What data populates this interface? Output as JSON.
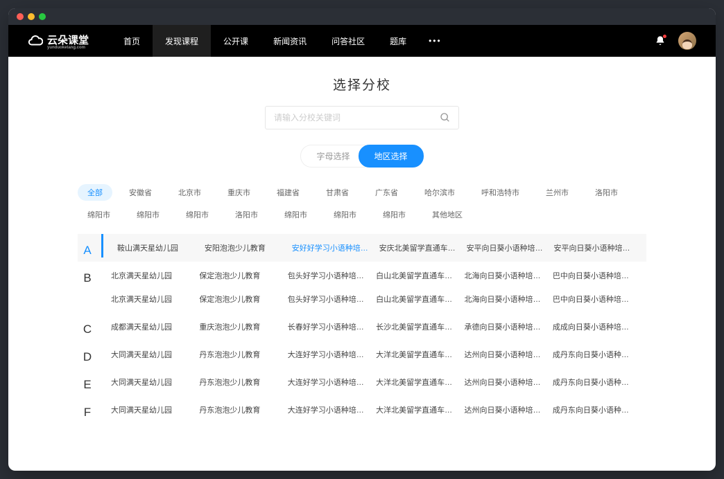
{
  "logo": {
    "text": "云朵课堂",
    "sub": "yunduoketang.com"
  },
  "nav": [
    "首页",
    "发现课程",
    "公开课",
    "新闻资讯",
    "问答社区",
    "题库"
  ],
  "nav_active": 1,
  "page_title": "选择分校",
  "search": {
    "placeholder": "请输入分校关键词"
  },
  "tabs": [
    "字母选择",
    "地区选择"
  ],
  "tab_active": 1,
  "regions": [
    "全部",
    "安徽省",
    "北京市",
    "重庆市",
    "福建省",
    "甘肃省",
    "广东省",
    "哈尔滨市",
    "呼和浩特市",
    "兰州市",
    "洛阳市",
    "绵阳市",
    "绵阳市",
    "绵阳市",
    "洛阳市",
    "绵阳市",
    "绵阳市",
    "绵阳市",
    "其他地区"
  ],
  "region_active": 0,
  "groups": [
    {
      "letter": "A",
      "highlighted": true,
      "highlight_idx": 2,
      "items": [
        "鞍山满天星幼儿园",
        "安阳泡泡少儿教育",
        "安好好学习小语种培训班",
        "安庆北美留学直通车分校",
        "安平向日葵小语种培训班",
        "安平向日葵小语种培训班"
      ]
    },
    {
      "letter": "B",
      "items": [
        "北京满天星幼儿园",
        "保定泡泡少儿教育",
        "包头好学习小语种培训班",
        "白山北美留学直通车分校",
        "北海向日葵小语种培训班",
        "巴中向日葵小语种培训班",
        "北京满天星幼儿园",
        "保定泡泡少儿教育",
        "包头好学习小语种培训班",
        "白山北美留学直通车分校",
        "北海向日葵小语种培训班",
        "巴中向日葵小语种培训班"
      ]
    },
    {
      "letter": "C",
      "items": [
        "成都满天星幼儿园",
        "重庆泡泡少儿教育",
        "长春好学习小语种培训班",
        "长沙北美留学直通车分校",
        "承德向日葵小语种培训班",
        "成成向日葵小语种培训班"
      ]
    },
    {
      "letter": "D",
      "items": [
        "大同满天星幼儿园",
        "丹东泡泡少儿教育",
        "大连好学习小语种培训班",
        "大洋北美留学直通车分校",
        "达州向日葵小语种培训班",
        "成丹东向日葵小语种培训班"
      ]
    },
    {
      "letter": "E",
      "items": [
        "大同满天星幼儿园",
        "丹东泡泡少儿教育",
        "大连好学习小语种培训班",
        "大洋北美留学直通车分校",
        "达州向日葵小语种培训班",
        "成丹东向日葵小语种培训班"
      ]
    },
    {
      "letter": "F",
      "items": [
        "大同满天星幼儿园",
        "丹东泡泡少儿教育",
        "大连好学习小语种培训班",
        "大洋北美留学直通车分校",
        "达州向日葵小语种培训班",
        "成丹东向日葵小语种培训班"
      ]
    }
  ]
}
